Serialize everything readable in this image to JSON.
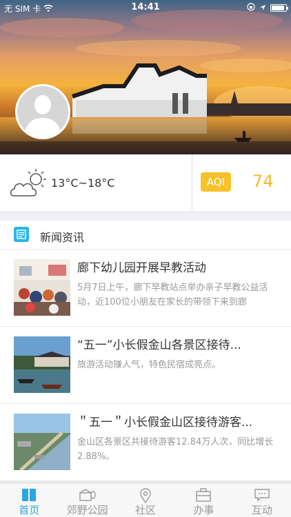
{
  "status_bar": {
    "carrier": "无 SIM 卡",
    "time": "14:41",
    "battery_level": 0.9
  },
  "weather": {
    "icon": "partly-cloudy-icon",
    "temperature": "13°C~18°C"
  },
  "aqi": {
    "label": "AQI",
    "value": "74",
    "color": "#f6c12a"
  },
  "news_section": {
    "title": "新闻资讯",
    "icon": "news-icon"
  },
  "news": [
    {
      "title": "廊下幼儿园开展早教活动",
      "summary": "5月7日上午，廊下早教站点举办亲子早教公益活动，近100位小朋友在家长的带领下来到廊"
    },
    {
      "title": "“五一”小长假金山各景区接待...",
      "summary": "旅游活动赚人气，特色民宿成亮点。"
    },
    {
      "title": "＂五一＂小长假金山区接待游客...",
      "summary": "金山区各景区共接待游客12.84万人次，同比增长2.88%。"
    }
  ],
  "tabs": [
    {
      "label": "首页",
      "icon": "home-icon",
      "active": true
    },
    {
      "label": "郊野公园",
      "icon": "park-icon",
      "active": false
    },
    {
      "label": "社区",
      "icon": "location-pin-icon",
      "active": false
    },
    {
      "label": "办事",
      "icon": "briefcase-icon",
      "active": false
    },
    {
      "label": "互动",
      "icon": "chat-icon",
      "active": false
    }
  ],
  "colors": {
    "accent": "#2aa7e0",
    "aqi": "#f5b81f"
  }
}
